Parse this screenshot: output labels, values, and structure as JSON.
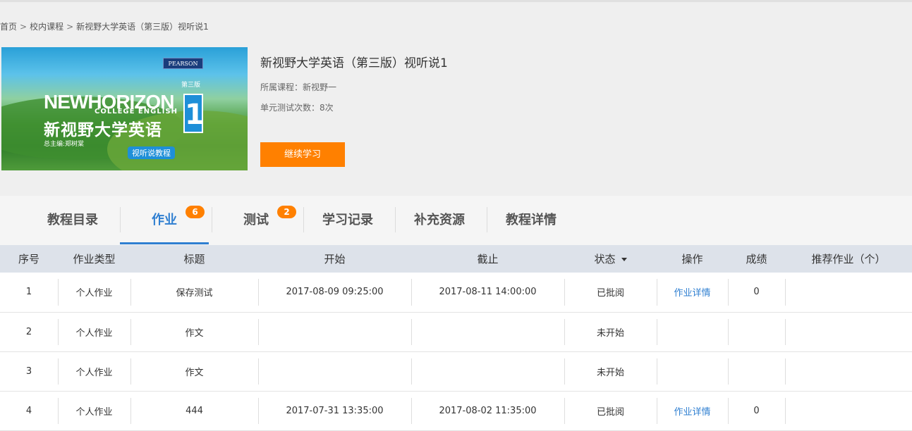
{
  "breadcrumb": {
    "items": [
      "首页",
      "校内课程",
      "新视野大学英语（第三版）视听说1"
    ],
    "separator": ">"
  },
  "course": {
    "cover": {
      "publisher": "PEARSON",
      "edition": "第三版",
      "series_en": "NEWHORIZON",
      "subtitle_en": "COLLEGE ENGLISH",
      "volume": "1",
      "series_zh": "新视野大学英语",
      "editor": "总主编:郑树棠",
      "tag": "视听说教程"
    },
    "title": "新视野大学英语（第三版）视听说1",
    "course_label": "所属课程：新视野一",
    "tests_label": "单元测试次数：8次",
    "continue_button": "继续学习"
  },
  "tabs": [
    {
      "label": "教程目录",
      "badge": ""
    },
    {
      "label": "作业",
      "badge": "6"
    },
    {
      "label": "测试",
      "badge": "2"
    },
    {
      "label": "学习记录",
      "badge": ""
    },
    {
      "label": "补充资源",
      "badge": ""
    },
    {
      "label": "教程详情",
      "badge": ""
    }
  ],
  "table": {
    "headers": [
      "序号",
      "作业类型",
      "标题",
      "开始",
      "截止",
      "状态",
      "操作",
      "成绩",
      "推荐作业（个）"
    ],
    "rows": [
      {
        "no": "1",
        "type": "个人作业",
        "title": "保存测试",
        "start": "2017-08-09 09:25:00",
        "end": "2017-08-11 14:00:00",
        "status": "已批阅",
        "action": "作业详情",
        "score": "0",
        "recommended": ""
      },
      {
        "no": "2",
        "type": "个人作业",
        "title": "作文",
        "start": "",
        "end": "",
        "status": "未开始",
        "action": "",
        "score": "",
        "recommended": ""
      },
      {
        "no": "3",
        "type": "个人作业",
        "title": "作文",
        "start": "",
        "end": "",
        "status": "未开始",
        "action": "",
        "score": "",
        "recommended": ""
      },
      {
        "no": "4",
        "type": "个人作业",
        "title": "444",
        "start": "2017-07-31 13:35:00",
        "end": "2017-08-02 11:35:00",
        "status": "已批阅",
        "action": "作业详情",
        "score": "0",
        "recommended": ""
      }
    ]
  },
  "colors": {
    "accent": "#2f7fd1",
    "button": "#ff8000",
    "header_bg": "#dde2ea"
  }
}
